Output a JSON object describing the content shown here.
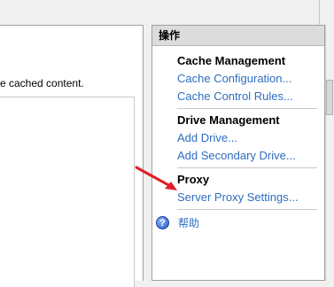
{
  "main": {
    "description_fragment": "e cached content."
  },
  "actions": {
    "header": "操作",
    "sections": [
      {
        "title": "Cache Management",
        "links": [
          "Cache Configuration...",
          "Cache Control Rules..."
        ]
      },
      {
        "title": "Drive Management",
        "links": [
          "Add Drive...",
          "Add Secondary Drive..."
        ]
      },
      {
        "title": "Proxy",
        "links": [
          "Server Proxy Settings..."
        ]
      }
    ],
    "help": "帮助"
  },
  "colors": {
    "link": "#2e6ebf",
    "annotation_arrow": "#e0202a",
    "header_bg": "#dcdcdc"
  }
}
